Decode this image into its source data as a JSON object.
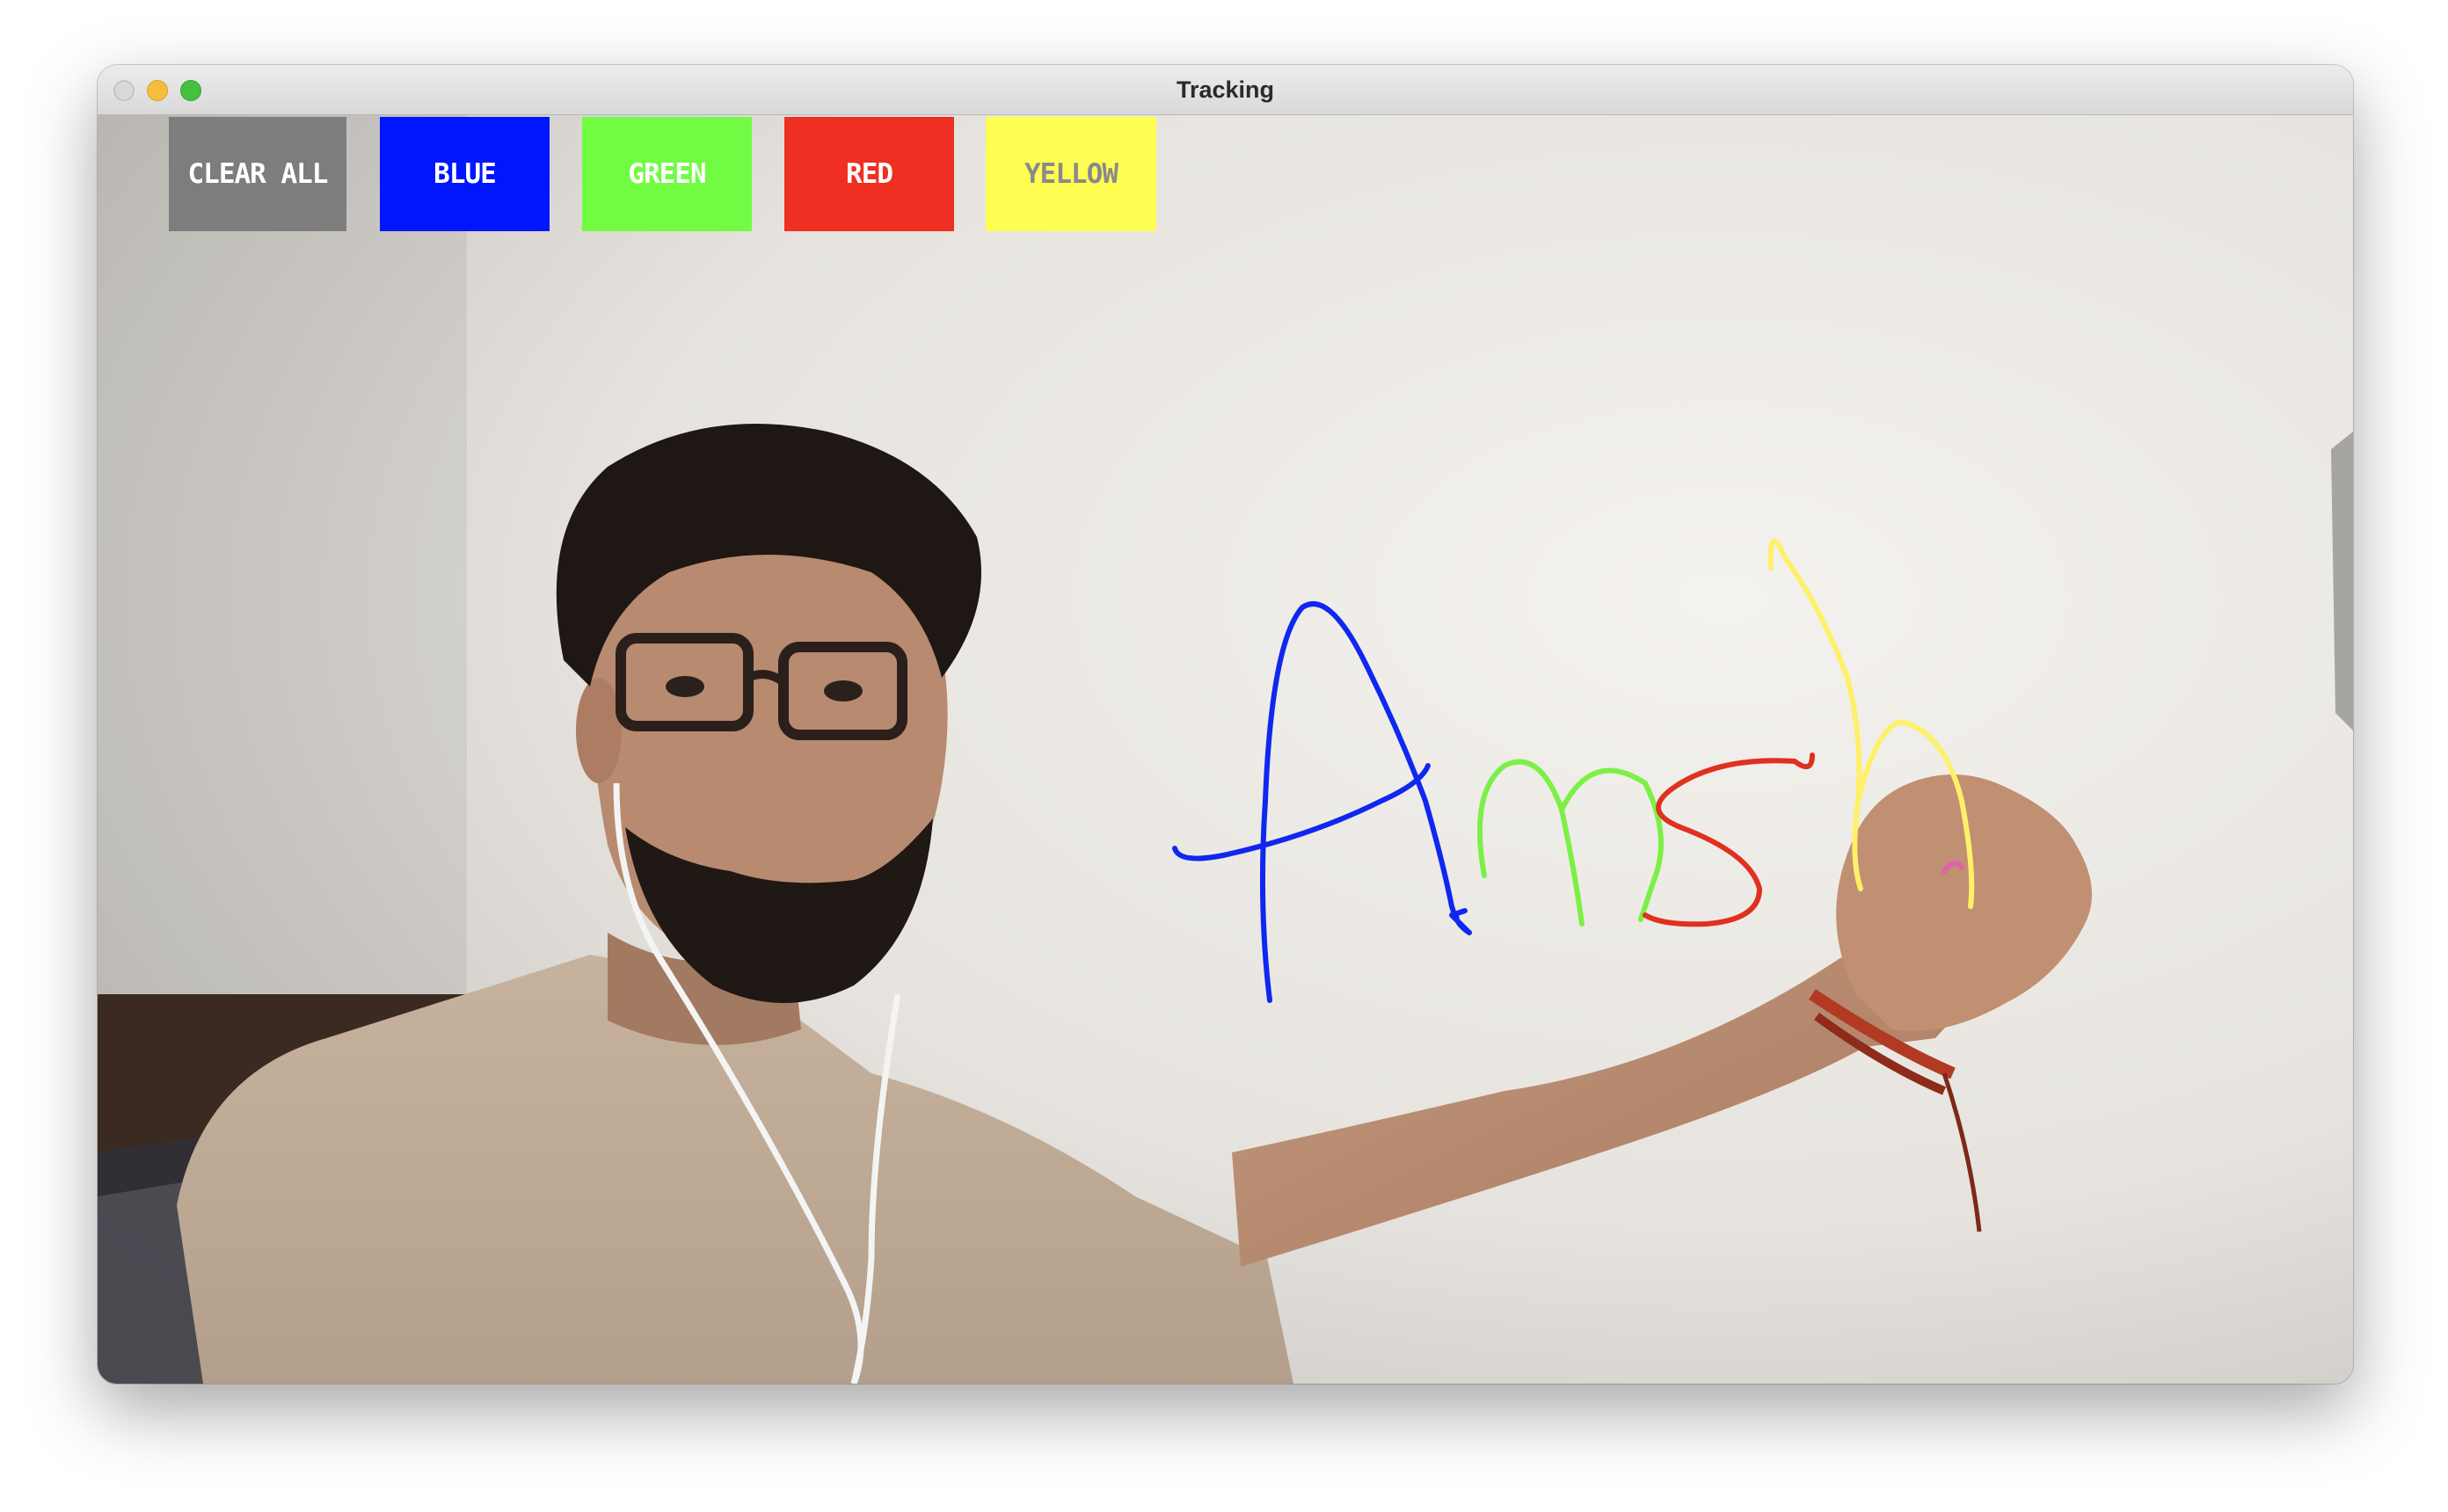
{
  "window": {
    "title": "Tracking"
  },
  "palette": {
    "clear_all": "CLEAR ALL",
    "blue": "BLUE",
    "green": "GREEN",
    "red": "RED",
    "yellow": "YELLOW"
  },
  "colors": {
    "clear": "#7d7d7d",
    "blue": "#0016ff",
    "green": "#72fb43",
    "red": "#ee2f22",
    "yellow": "#fffe52"
  },
  "drawing": {
    "strokes": [
      {
        "letter": "A",
        "color": "blue"
      },
      {
        "letter": "n",
        "color": "green"
      },
      {
        "letter": "s",
        "color": "red"
      },
      {
        "letter": "h",
        "color": "yellow"
      }
    ]
  }
}
